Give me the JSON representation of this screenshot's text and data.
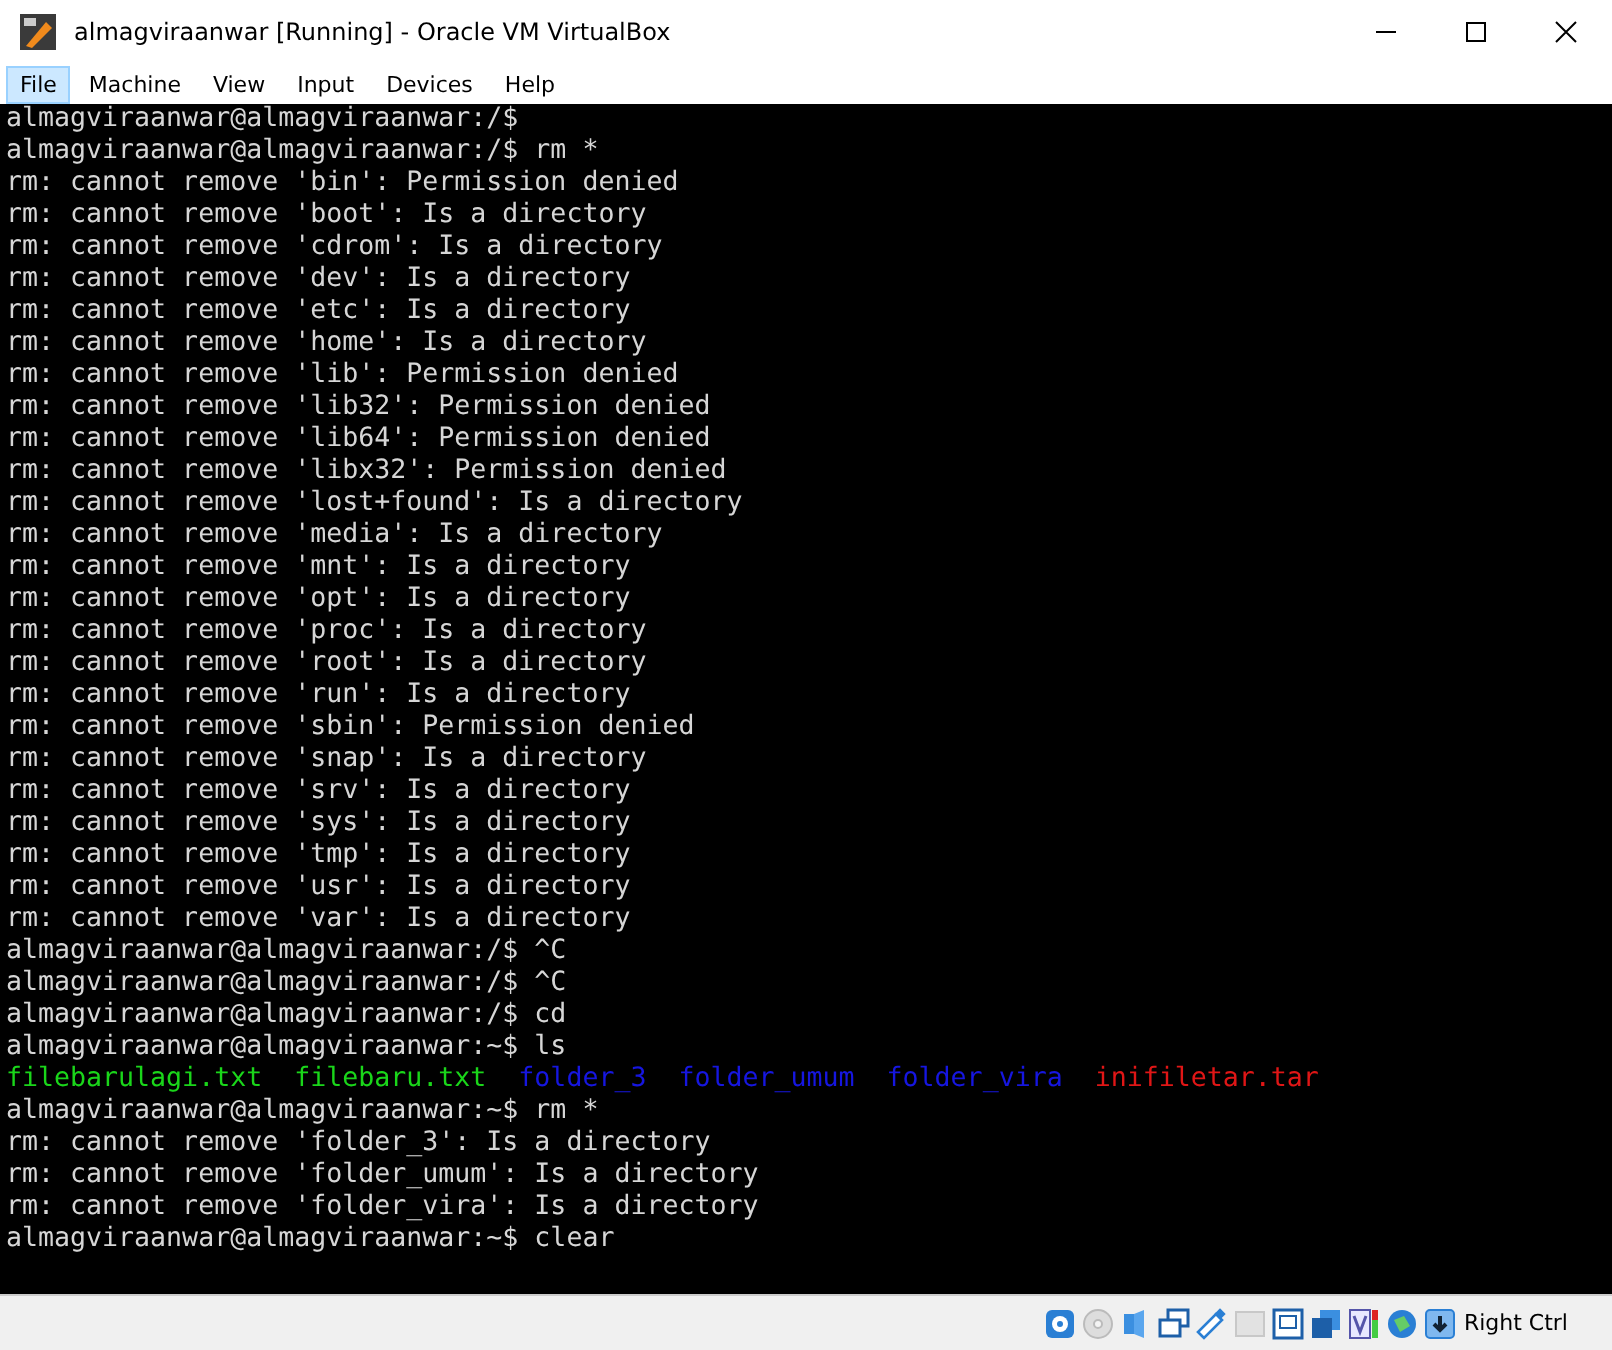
{
  "window": {
    "title": "almagviraanwar [Running] - Oracle VM VirtualBox"
  },
  "menu": [
    {
      "label": "File",
      "selected": true
    },
    {
      "label": "Machine",
      "selected": false
    },
    {
      "label": "View",
      "selected": false
    },
    {
      "label": "Input",
      "selected": false
    },
    {
      "label": "Devices",
      "selected": false
    },
    {
      "label": "Help",
      "selected": false
    }
  ],
  "terminal": {
    "lines": [
      {
        "kind": "text",
        "text": "almagviraanwar@almagviraanwar:/$"
      },
      {
        "kind": "text",
        "text": "almagviraanwar@almagviraanwar:/$ rm *"
      },
      {
        "kind": "text",
        "text": "rm: cannot remove 'bin': Permission denied"
      },
      {
        "kind": "text",
        "text": "rm: cannot remove 'boot': Is a directory"
      },
      {
        "kind": "text",
        "text": "rm: cannot remove 'cdrom': Is a directory"
      },
      {
        "kind": "text",
        "text": "rm: cannot remove 'dev': Is a directory"
      },
      {
        "kind": "text",
        "text": "rm: cannot remove 'etc': Is a directory"
      },
      {
        "kind": "text",
        "text": "rm: cannot remove 'home': Is a directory"
      },
      {
        "kind": "text",
        "text": "rm: cannot remove 'lib': Permission denied"
      },
      {
        "kind": "text",
        "text": "rm: cannot remove 'lib32': Permission denied"
      },
      {
        "kind": "text",
        "text": "rm: cannot remove 'lib64': Permission denied"
      },
      {
        "kind": "text",
        "text": "rm: cannot remove 'libx32': Permission denied"
      },
      {
        "kind": "text",
        "text": "rm: cannot remove 'lost+found': Is a directory"
      },
      {
        "kind": "text",
        "text": "rm: cannot remove 'media': Is a directory"
      },
      {
        "kind": "text",
        "text": "rm: cannot remove 'mnt': Is a directory"
      },
      {
        "kind": "text",
        "text": "rm: cannot remove 'opt': Is a directory"
      },
      {
        "kind": "text",
        "text": "rm: cannot remove 'proc': Is a directory"
      },
      {
        "kind": "text",
        "text": "rm: cannot remove 'root': Is a directory"
      },
      {
        "kind": "text",
        "text": "rm: cannot remove 'run': Is a directory"
      },
      {
        "kind": "text",
        "text": "rm: cannot remove 'sbin': Permission denied"
      },
      {
        "kind": "text",
        "text": "rm: cannot remove 'snap': Is a directory"
      },
      {
        "kind": "text",
        "text": "rm: cannot remove 'srv': Is a directory"
      },
      {
        "kind": "text",
        "text": "rm: cannot remove 'sys': Is a directory"
      },
      {
        "kind": "text",
        "text": "rm: cannot remove 'tmp': Is a directory"
      },
      {
        "kind": "text",
        "text": "rm: cannot remove 'usr': Is a directory"
      },
      {
        "kind": "text",
        "text": "rm: cannot remove 'var': Is a directory"
      },
      {
        "kind": "text",
        "text": "almagviraanwar@almagviraanwar:/$ ^C"
      },
      {
        "kind": "text",
        "text": "almagviraanwar@almagviraanwar:/$ ^C"
      },
      {
        "kind": "text",
        "text": "almagviraanwar@almagviraanwar:/$ cd"
      },
      {
        "kind": "text",
        "text": "almagviraanwar@almagviraanwar:~$ ls"
      },
      {
        "kind": "listing",
        "entries": [
          {
            "name": "filebarulagi.txt",
            "kind": "file"
          },
          {
            "name": "filebaru.txt",
            "kind": "file"
          },
          {
            "name": "folder_3",
            "kind": "dir"
          },
          {
            "name": "folder_umum",
            "kind": "dir"
          },
          {
            "name": "folder_vira",
            "kind": "dir"
          },
          {
            "name": "inifiletar.tar",
            "kind": "archive"
          }
        ]
      },
      {
        "kind": "text",
        "text": "almagviraanwar@almagviraanwar:~$ rm *"
      },
      {
        "kind": "text",
        "text": "rm: cannot remove 'folder_3': Is a directory"
      },
      {
        "kind": "text",
        "text": "rm: cannot remove 'folder_umum': Is a directory"
      },
      {
        "kind": "text",
        "text": "rm: cannot remove 'folder_vira': Is a directory"
      },
      {
        "kind": "text",
        "text": "almagviraanwar@almagviraanwar:~$ clear"
      }
    ]
  },
  "status_bar": {
    "host_key": "Right Ctrl"
  }
}
